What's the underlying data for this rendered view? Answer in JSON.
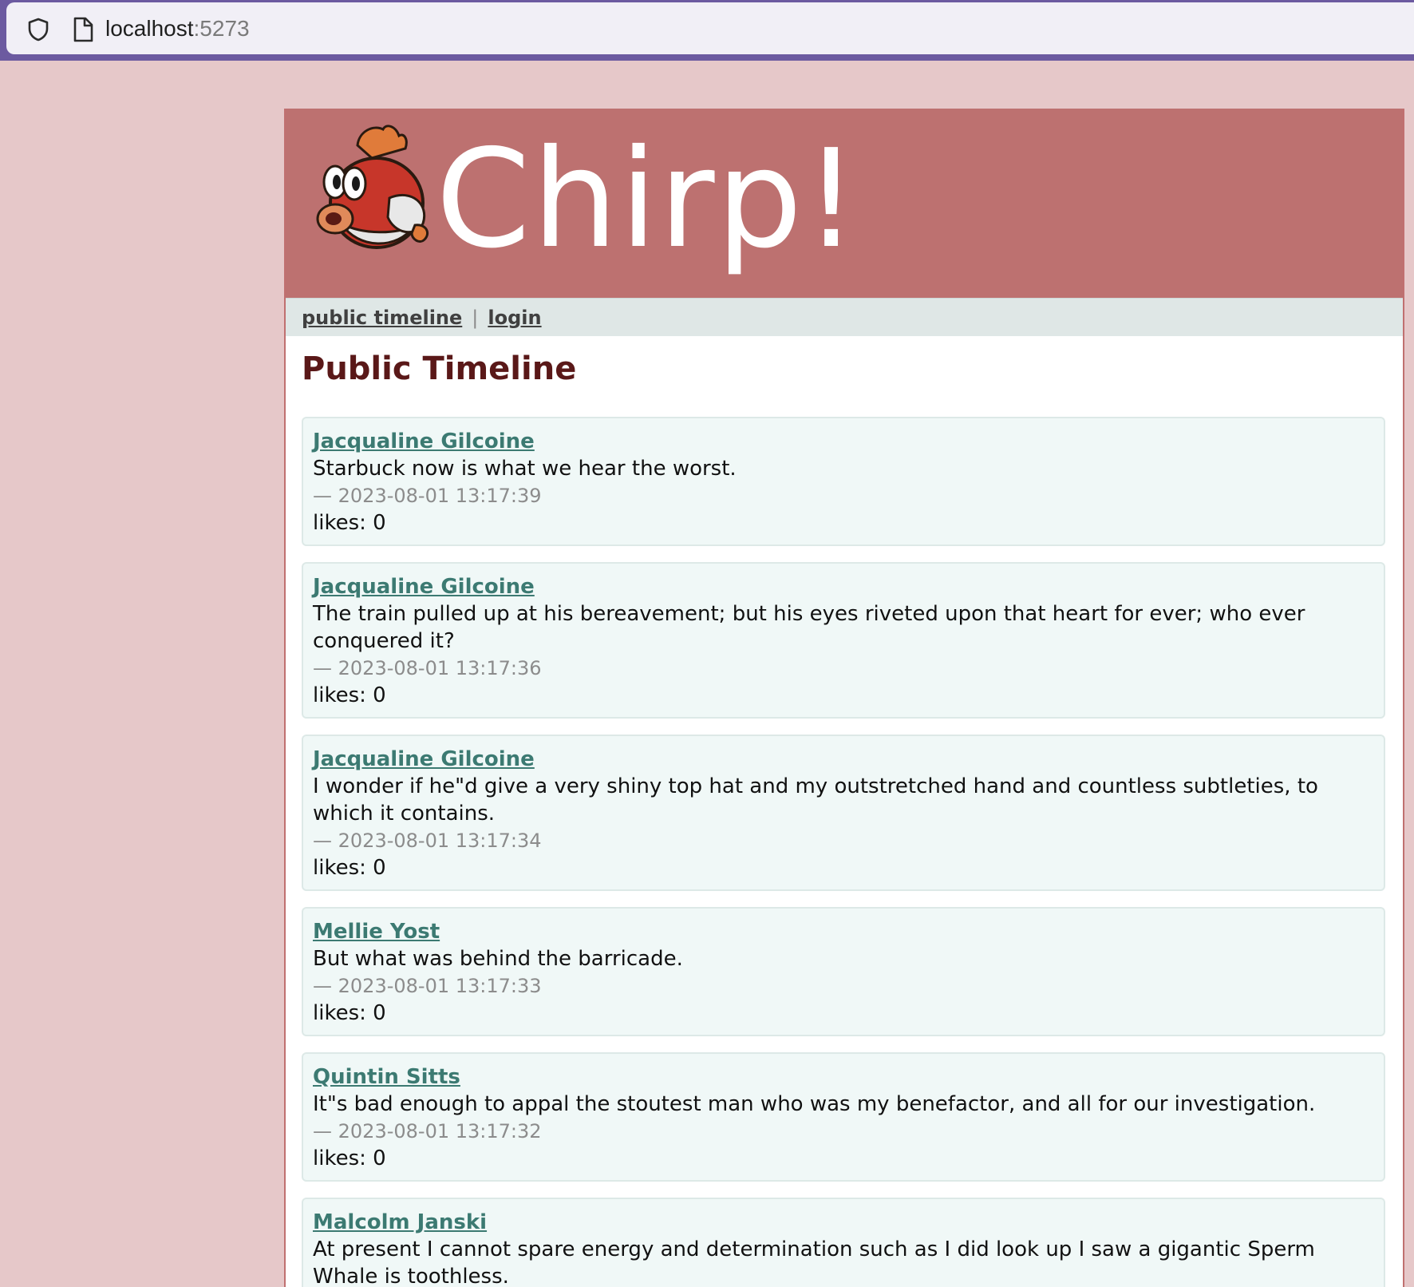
{
  "browser": {
    "url_host": "localhost",
    "url_port": ":5273"
  },
  "site": {
    "title": "Chirp!"
  },
  "nav": {
    "items": [
      {
        "label": "public timeline"
      },
      {
        "label": "login"
      }
    ],
    "separator": "|"
  },
  "main": {
    "heading": "Public Timeline",
    "posts": [
      {
        "author": "Jacqualine Gilcoine",
        "text": "Starbuck now is what we hear the worst.",
        "time": "— 2023-08-01 13:17:39",
        "likes": "likes: 0"
      },
      {
        "author": "Jacqualine Gilcoine",
        "text": "The train pulled up at his bereavement; but his eyes riveted upon that heart for ever; who ever conquered it?",
        "time": "— 2023-08-01 13:17:36",
        "likes": "likes: 0"
      },
      {
        "author": "Jacqualine Gilcoine",
        "text": "I wonder if he\"d give a very shiny top hat and my outstretched hand and countless subtleties, to which it contains.",
        "time": "— 2023-08-01 13:17:34",
        "likes": "likes: 0"
      },
      {
        "author": "Mellie Yost",
        "text": "But what was behind the barricade.",
        "time": "— 2023-08-01 13:17:33",
        "likes": "likes: 0"
      },
      {
        "author": "Quintin Sitts",
        "text": "It\"s bad enough to appal the stoutest man who was my benefactor, and all for our investigation.",
        "time": "— 2023-08-01 13:17:32",
        "likes": "likes: 0"
      },
      {
        "author": "Malcolm Janski",
        "text": "At present I cannot spare energy and determination such as I did look up I saw a gigantic Sperm Whale is toothless.",
        "time": "",
        "likes": ""
      }
    ]
  },
  "colors": {
    "background": "#e6c8c9",
    "header": "#bd7170",
    "nav": "#dfe7e6",
    "heading": "#5a1818",
    "author_link": "#3c7a72",
    "post_bg": "#f0f8f7"
  },
  "icons": {
    "shield": "shield-icon",
    "page": "page-icon",
    "logo": "cheep-cheep-bird-logo"
  }
}
